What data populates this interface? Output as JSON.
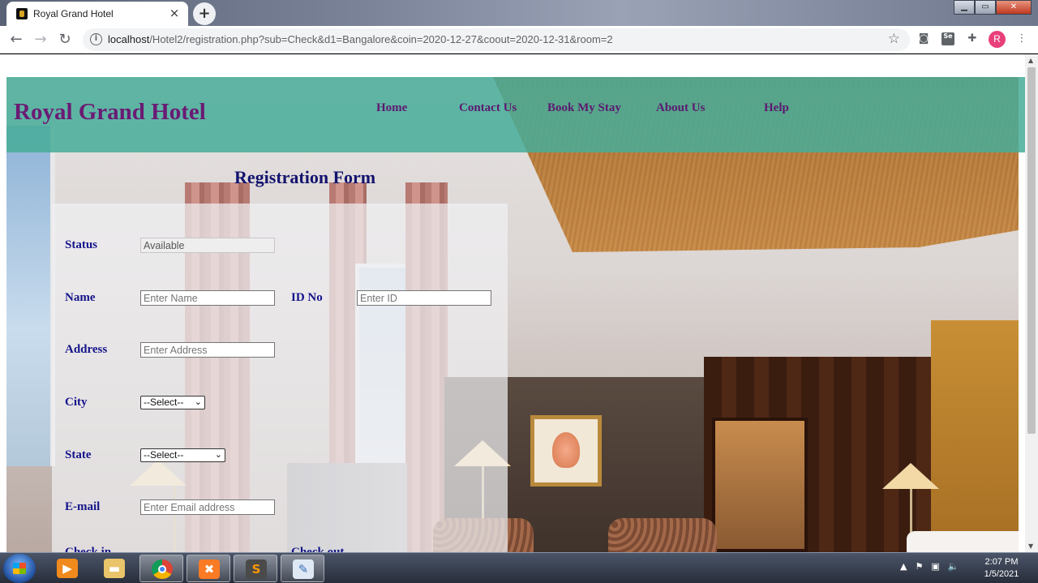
{
  "browser": {
    "tab_title": "Royal Grand Hotel",
    "close_glyph": "×",
    "new_tab_glyph": "+",
    "window_controls": {
      "minimize": "▁",
      "maximize": "▭",
      "close": "✕"
    },
    "url_host": "localhost",
    "url_rest": "/Hotel2/registration.php?sub=Check&d1=Bangalore&coin=2020-12-27&coout=2020-12-31&room=2",
    "profile_initial": "R",
    "icons": [
      "back-icon",
      "forward-icon",
      "reload-icon",
      "info-icon",
      "star-icon",
      "camera-extension-icon",
      "selenium-extension-icon",
      "puzzle-extension-icon",
      "menu-icon"
    ]
  },
  "header": {
    "title": "Royal Grand Hotel",
    "nav": [
      "Home",
      "Contact Us",
      "Book My Stay",
      "About Us",
      "Help"
    ],
    "accent": "#48ac98",
    "title_color": "#6a1b74"
  },
  "form": {
    "title": "Registration Form",
    "status_label": "Status",
    "status_value": "Available",
    "name_label": "Name",
    "name_placeholder": "Enter Name",
    "id_label": "ID No",
    "id_placeholder": "Enter ID",
    "address_label": "Address",
    "address_placeholder": "Enter Address",
    "city_label": "City",
    "city_selected": "--Select--",
    "state_label": "State",
    "state_selected": "--Select--",
    "email_label": "E-mail",
    "email_placeholder": "Enter Email address",
    "checkin_label": "Check in",
    "checkout_label": "Check out",
    "label_color": "#14148a"
  },
  "taskbar": {
    "apps": [
      "windows-explorer",
      "media-player",
      "file-explorer",
      "chrome",
      "xampp",
      "sublime-text",
      "paint"
    ],
    "time": "2:07 PM",
    "date": "1/5/2021"
  }
}
